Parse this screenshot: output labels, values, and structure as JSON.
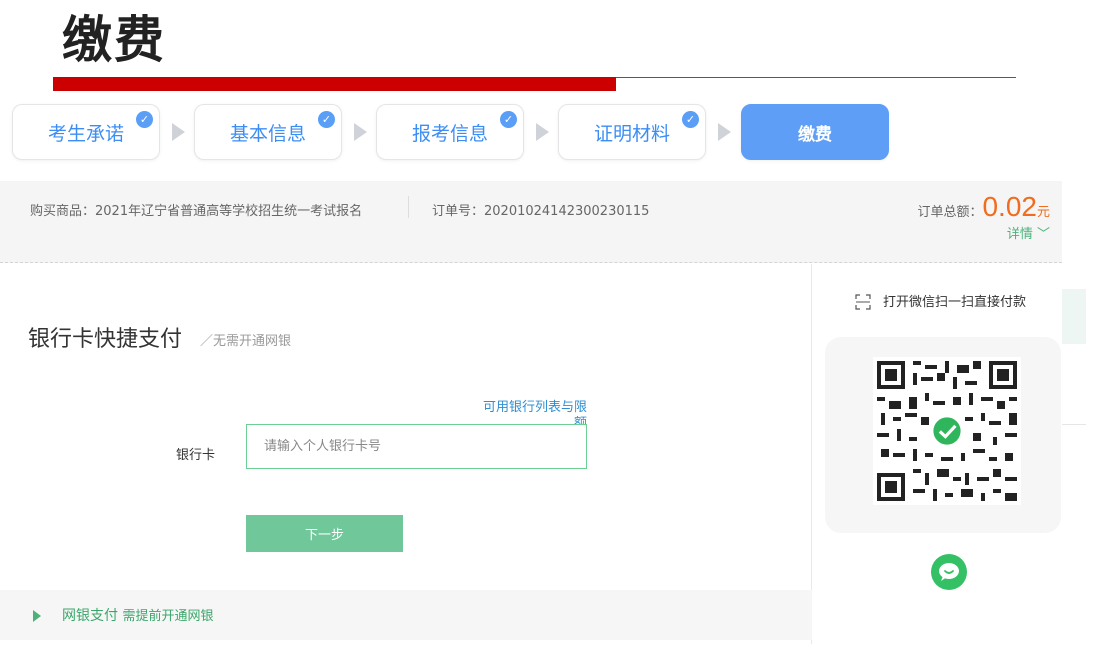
{
  "page": {
    "title": "缴费"
  },
  "steps": [
    {
      "label": "考生承诺",
      "done": true
    },
    {
      "label": "基本信息",
      "done": true
    },
    {
      "label": "报考信息",
      "done": true
    },
    {
      "label": "证明材料",
      "done": true
    },
    {
      "label": "缴费",
      "done": false,
      "active": true
    }
  ],
  "order": {
    "product": "购买商品：2021年辽宁省普通高等学校招生统一考试报名",
    "number": "订单号：20201024142300230115",
    "total_label": "订单总额：",
    "total_amount": "0.02",
    "total_unit": "元",
    "detail_label": "详情"
  },
  "bank_pay": {
    "title": "银行卡快捷支付",
    "subtitle": "无需开通网银",
    "bank_list_link": "可用银行列表与限额",
    "card_label": "银行卡",
    "card_placeholder": "请输入个人银行卡号",
    "card_value": "",
    "next_button": "下一步"
  },
  "netbank": {
    "label": "网银支付",
    "note": "需提前开通网银"
  },
  "wechat": {
    "tip": "打开微信扫一扫直接付款"
  },
  "colors": {
    "accent": "#5e9ef6",
    "amount": "#f06c1e",
    "green": "#6fc79a",
    "title_rule": "#cc0000"
  },
  "icons": {
    "step_check": "check-circle-icon",
    "arrow": "step-arrow-icon",
    "scan": "scan-icon",
    "qr": "qr-code-icon",
    "wechat": "wechat-icon",
    "expand": "chevron-down-icon",
    "netbank_toggle": "triangle-right-icon"
  }
}
